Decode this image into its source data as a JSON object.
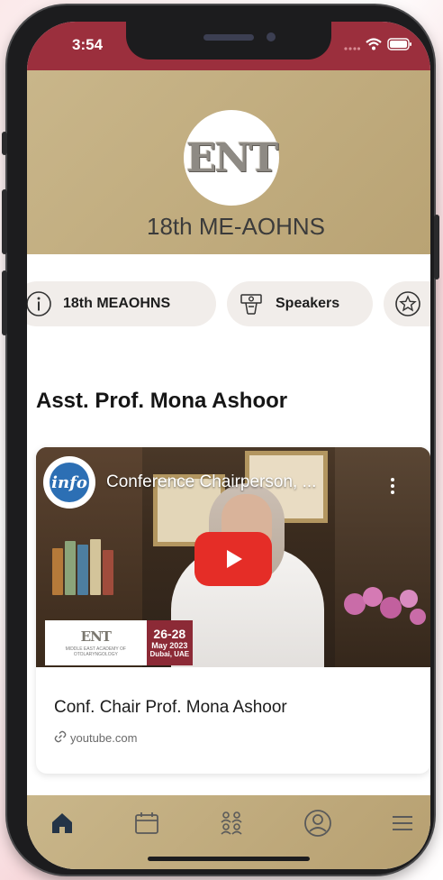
{
  "status_bar": {
    "time": "3:54"
  },
  "header": {
    "logo_text": "ENT",
    "title": "18th ME-AOHNS"
  },
  "chips": [
    {
      "label": "18th MEAOHNS",
      "icon": "info-icon"
    },
    {
      "label": "Speakers",
      "icon": "speaker-podium-icon"
    },
    {
      "label": "",
      "icon": "star-badge-icon"
    }
  ],
  "speaker": {
    "name": "Asst. Prof. Mona Ashoor"
  },
  "video_card": {
    "video_title": "Conference Chairperson, ...",
    "channel_badge": "info",
    "banner": {
      "logo": "ENT",
      "subtitle": "MIDDLE EAST ACADEMY OF OTOLARYNGOLOGY",
      "dates": "26-28",
      "month": "May 2023",
      "city": "Dubai, UAE"
    },
    "title": "Conf. Chair Prof. Mona Ashoor",
    "link": "youtube.com"
  },
  "tab_bar": [
    {
      "icon": "home-icon",
      "active": true
    },
    {
      "icon": "calendar-icon",
      "active": false
    },
    {
      "icon": "people-icon",
      "active": false
    },
    {
      "icon": "profile-icon",
      "active": false
    },
    {
      "icon": "menu-icon",
      "active": false
    }
  ],
  "colors": {
    "accent_red": "#9b2f3d",
    "gold": "#c9b68a",
    "dark_icon": "#243447"
  }
}
